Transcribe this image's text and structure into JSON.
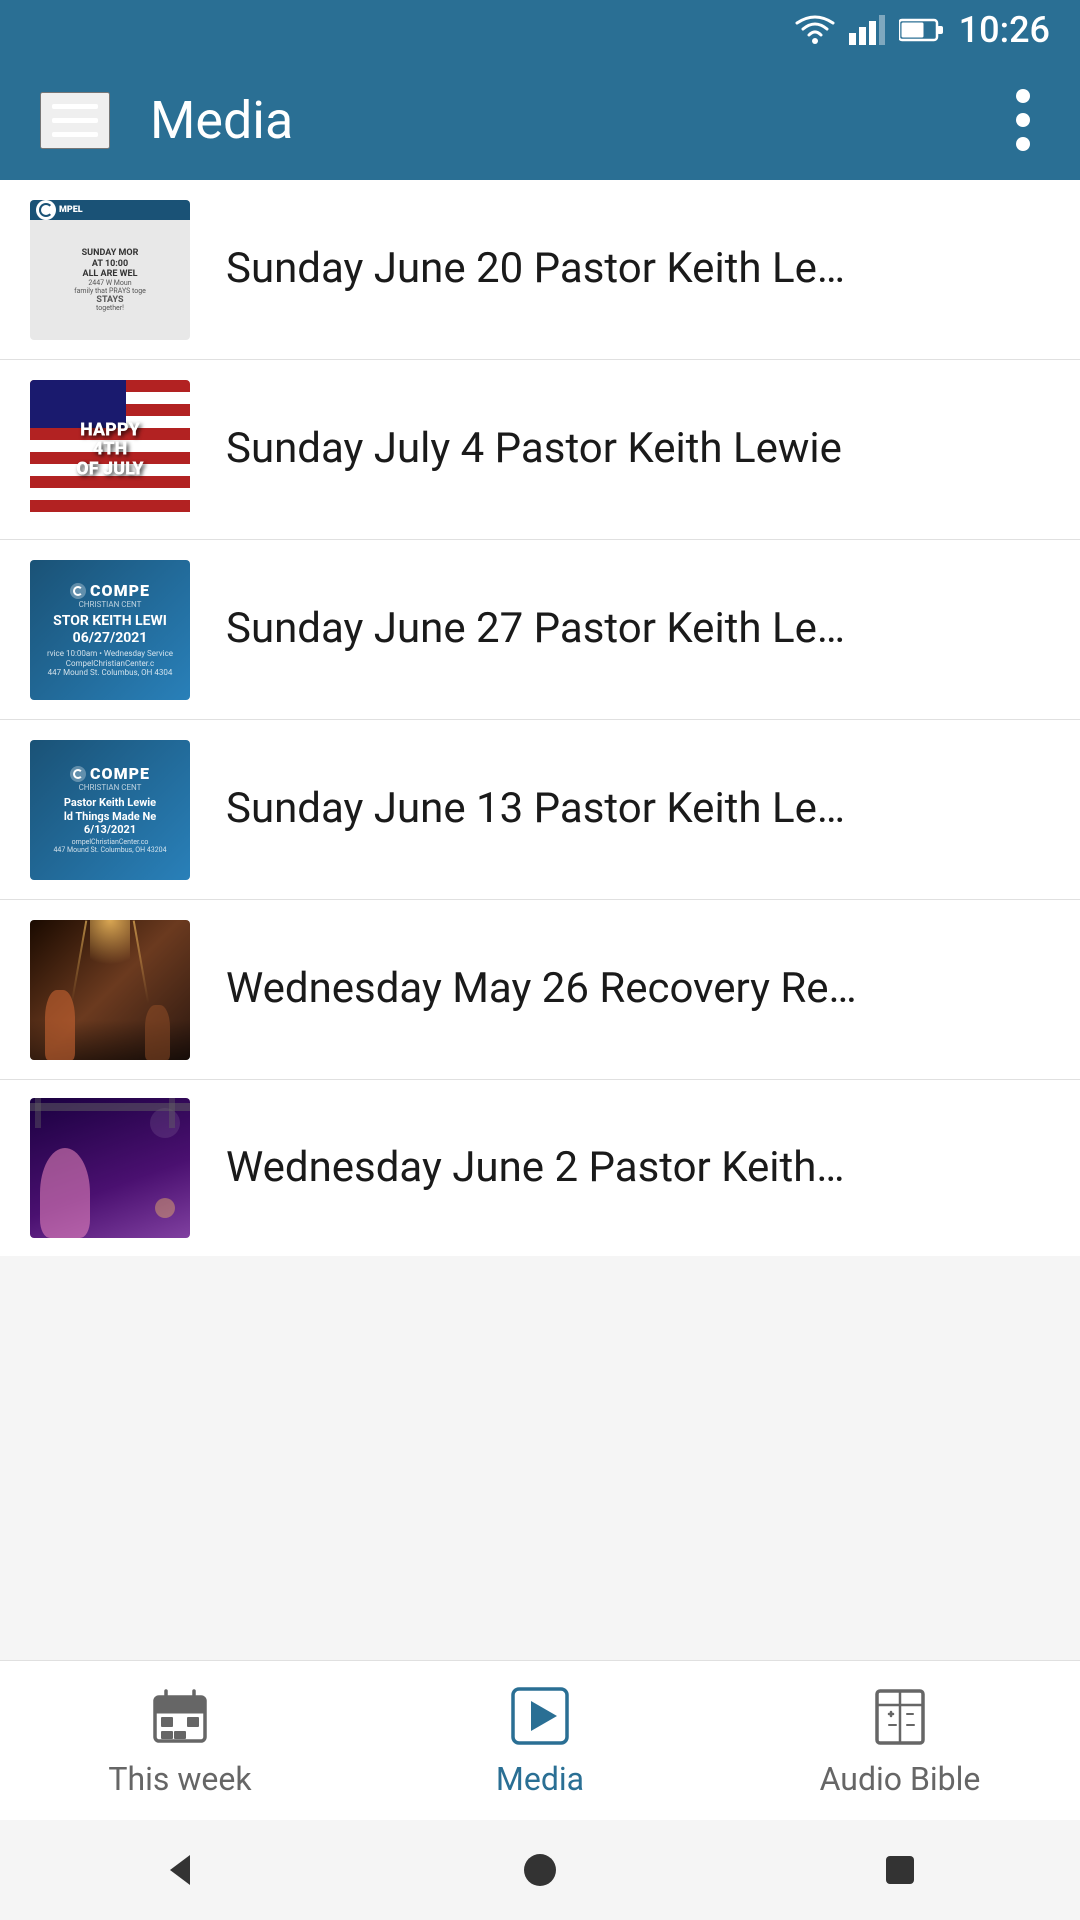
{
  "statusBar": {
    "time": "10:26"
  },
  "appBar": {
    "title": "Media",
    "menuLabel": "Menu",
    "overflowLabel": "More options"
  },
  "mediaItems": [
    {
      "id": "item-1",
      "title": "Sunday June 20 Pastor Keith Le…",
      "thumbType": "sunday-june20"
    },
    {
      "id": "item-2",
      "title": "Sunday July 4 Pastor Keith Lewie",
      "thumbType": "july4"
    },
    {
      "id": "item-3",
      "title": "Sunday June 27 Pastor Keith Le…",
      "thumbType": "compel-blue"
    },
    {
      "id": "item-4",
      "title": "Sunday June 13 Pastor Keith Le…",
      "thumbType": "compel-blue2"
    },
    {
      "id": "item-5",
      "title": "Wednesday May 26 Recovery Re…",
      "thumbType": "may26"
    },
    {
      "id": "item-6",
      "title": "Wednesday June 2 Pastor Keith…",
      "thumbType": "june2"
    }
  ],
  "bottomNav": {
    "items": [
      {
        "id": "this-week",
        "label": "This week",
        "active": false,
        "iconType": "calendar"
      },
      {
        "id": "media",
        "label": "Media",
        "active": true,
        "iconType": "play"
      },
      {
        "id": "audio-bible",
        "label": "Audio Bible",
        "active": false,
        "iconType": "book"
      }
    ]
  },
  "systemNav": {
    "backLabel": "Back",
    "homeLabel": "Home",
    "recentLabel": "Recent"
  }
}
